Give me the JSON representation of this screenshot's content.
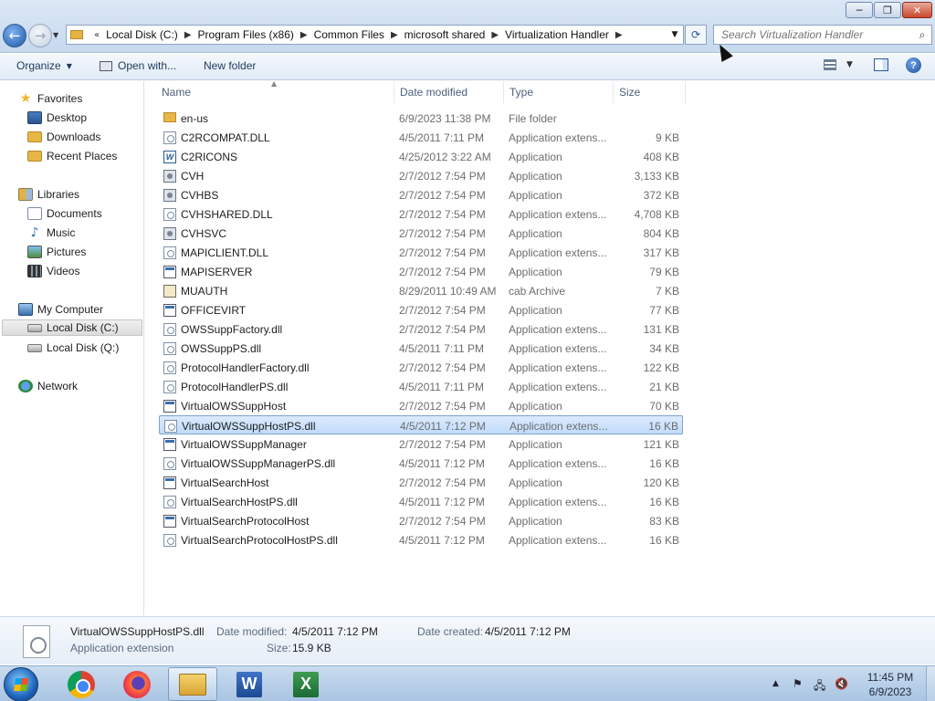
{
  "window": {
    "minimize_glyph": "─",
    "maximize_glyph": "❐",
    "close_glyph": "✕"
  },
  "navigation": {
    "back_glyph": "←",
    "forward_glyph": "→",
    "history_glyph": "▼",
    "address_overflow": "«",
    "breadcrumbs": [
      "Local Disk (C:)",
      "Program Files (x86)",
      "Common Files",
      "microsoft shared",
      "Virtualization Handler"
    ],
    "crumb_separator": "▶",
    "refresh_glyph": "⟳",
    "search_placeholder": "Search Virtualization Handler"
  },
  "toolbar": {
    "organize": "Organize",
    "open_with": "Open with...",
    "new_folder": "New folder",
    "caret": "▼",
    "help": "?"
  },
  "sidebar": {
    "favorites": "Favorites",
    "desktop": "Desktop",
    "downloads": "Downloads",
    "recent_places": "Recent Places",
    "libraries": "Libraries",
    "documents": "Documents",
    "music": "Music",
    "pictures": "Pictures",
    "videos": "Videos",
    "my_computer": "My Computer",
    "local_disk_c": "Local Disk (C:)",
    "local_disk_q": "Local Disk (Q:)",
    "network": "Network"
  },
  "columns": {
    "name": "Name",
    "date_modified": "Date modified",
    "type": "Type",
    "size": "Size",
    "sort_glyph": "▲"
  },
  "files": [
    {
      "name": "en-us",
      "date": "6/9/2023 11:38 PM",
      "type": "File folder",
      "size": "",
      "icon": "folder-icon"
    },
    {
      "name": "C2RCOMPAT.DLL",
      "date": "4/5/2011 7:11 PM",
      "type": "Application extens...",
      "size": "9 KB",
      "icon": "dll-icon"
    },
    {
      "name": "C2RICONS",
      "date": "4/25/2012 3:22 AM",
      "type": "Application",
      "size": "408 KB",
      "icon": "word-app-icon"
    },
    {
      "name": "CVH",
      "date": "2/7/2012 7:54 PM",
      "type": "Application",
      "size": "3,133 KB",
      "icon": "gear-app-icon"
    },
    {
      "name": "CVHBS",
      "date": "2/7/2012 7:54 PM",
      "type": "Application",
      "size": "372 KB",
      "icon": "gear-app-icon"
    },
    {
      "name": "CVHSHARED.DLL",
      "date": "2/7/2012 7:54 PM",
      "type": "Application extens...",
      "size": "4,708 KB",
      "icon": "dll-icon"
    },
    {
      "name": "CVHSVC",
      "date": "2/7/2012 7:54 PM",
      "type": "Application",
      "size": "804 KB",
      "icon": "gear-app-icon"
    },
    {
      "name": "MAPICLIENT.DLL",
      "date": "2/7/2012 7:54 PM",
      "type": "Application extens...",
      "size": "317 KB",
      "icon": "dll-icon"
    },
    {
      "name": "MAPISERVER",
      "date": "2/7/2012 7:54 PM",
      "type": "Application",
      "size": "79 KB",
      "icon": "app-icon"
    },
    {
      "name": "MUAUTH",
      "date": "8/29/2011 10:49 AM",
      "type": "cab Archive",
      "size": "7 KB",
      "icon": "cab-icon"
    },
    {
      "name": "OFFICEVIRT",
      "date": "2/7/2012 7:54 PM",
      "type": "Application",
      "size": "77 KB",
      "icon": "app-icon"
    },
    {
      "name": "OWSSuppFactory.dll",
      "date": "2/7/2012 7:54 PM",
      "type": "Application extens...",
      "size": "131 KB",
      "icon": "dll-icon"
    },
    {
      "name": "OWSSuppPS.dll",
      "date": "4/5/2011 7:11 PM",
      "type": "Application extens...",
      "size": "34 KB",
      "icon": "dll-icon"
    },
    {
      "name": "ProtocolHandlerFactory.dll",
      "date": "2/7/2012 7:54 PM",
      "type": "Application extens...",
      "size": "122 KB",
      "icon": "dll-icon"
    },
    {
      "name": "ProtocolHandlerPS.dll",
      "date": "4/5/2011 7:11 PM",
      "type": "Application extens...",
      "size": "21 KB",
      "icon": "dll-icon"
    },
    {
      "name": "VirtualOWSSuppHost",
      "date": "2/7/2012 7:54 PM",
      "type": "Application",
      "size": "70 KB",
      "icon": "app-icon"
    },
    {
      "name": "VirtualOWSSuppHostPS.dll",
      "date": "4/5/2011 7:12 PM",
      "type": "Application extens...",
      "size": "16 KB",
      "icon": "dll-icon",
      "selected": true
    },
    {
      "name": "VirtualOWSSuppManager",
      "date": "2/7/2012 7:54 PM",
      "type": "Application",
      "size": "121 KB",
      "icon": "app-icon"
    },
    {
      "name": "VirtualOWSSuppManagerPS.dll",
      "date": "4/5/2011 7:12 PM",
      "type": "Application extens...",
      "size": "16 KB",
      "icon": "dll-icon"
    },
    {
      "name": "VirtualSearchHost",
      "date": "2/7/2012 7:54 PM",
      "type": "Application",
      "size": "120 KB",
      "icon": "app-icon"
    },
    {
      "name": "VirtualSearchHostPS.dll",
      "date": "4/5/2011 7:12 PM",
      "type": "Application extens...",
      "size": "16 KB",
      "icon": "dll-icon"
    },
    {
      "name": "VirtualSearchProtocolHost",
      "date": "2/7/2012 7:54 PM",
      "type": "Application",
      "size": "83 KB",
      "icon": "app-icon"
    },
    {
      "name": "VirtualSearchProtocolHostPS.dll",
      "date": "4/5/2011 7:12 PM",
      "type": "Application extens...",
      "size": "16 KB",
      "icon": "dll-icon"
    }
  ],
  "details": {
    "filename": "VirtualOWSSuppHostPS.dll",
    "filetype": "Application extension",
    "date_modified_label": "Date modified:",
    "date_modified_value": "4/5/2011 7:12 PM",
    "date_created_label": "Date created:",
    "date_created_value": "4/5/2011 7:12 PM",
    "size_label": "Size:",
    "size_value": "15.9 KB"
  },
  "taskbar": {
    "word_letter": "W",
    "excel_letter": "X",
    "tray_chevron": "▲",
    "flag_glyph": "⚑",
    "network_glyph": "🖧",
    "volume_glyph": "🔇",
    "time": "11:45 PM",
    "date": "6/9/2023"
  },
  "colors": {
    "selection_bg": "#c1dbfc",
    "selection_border": "#7da2ce",
    "accent": "#1e56a8"
  }
}
